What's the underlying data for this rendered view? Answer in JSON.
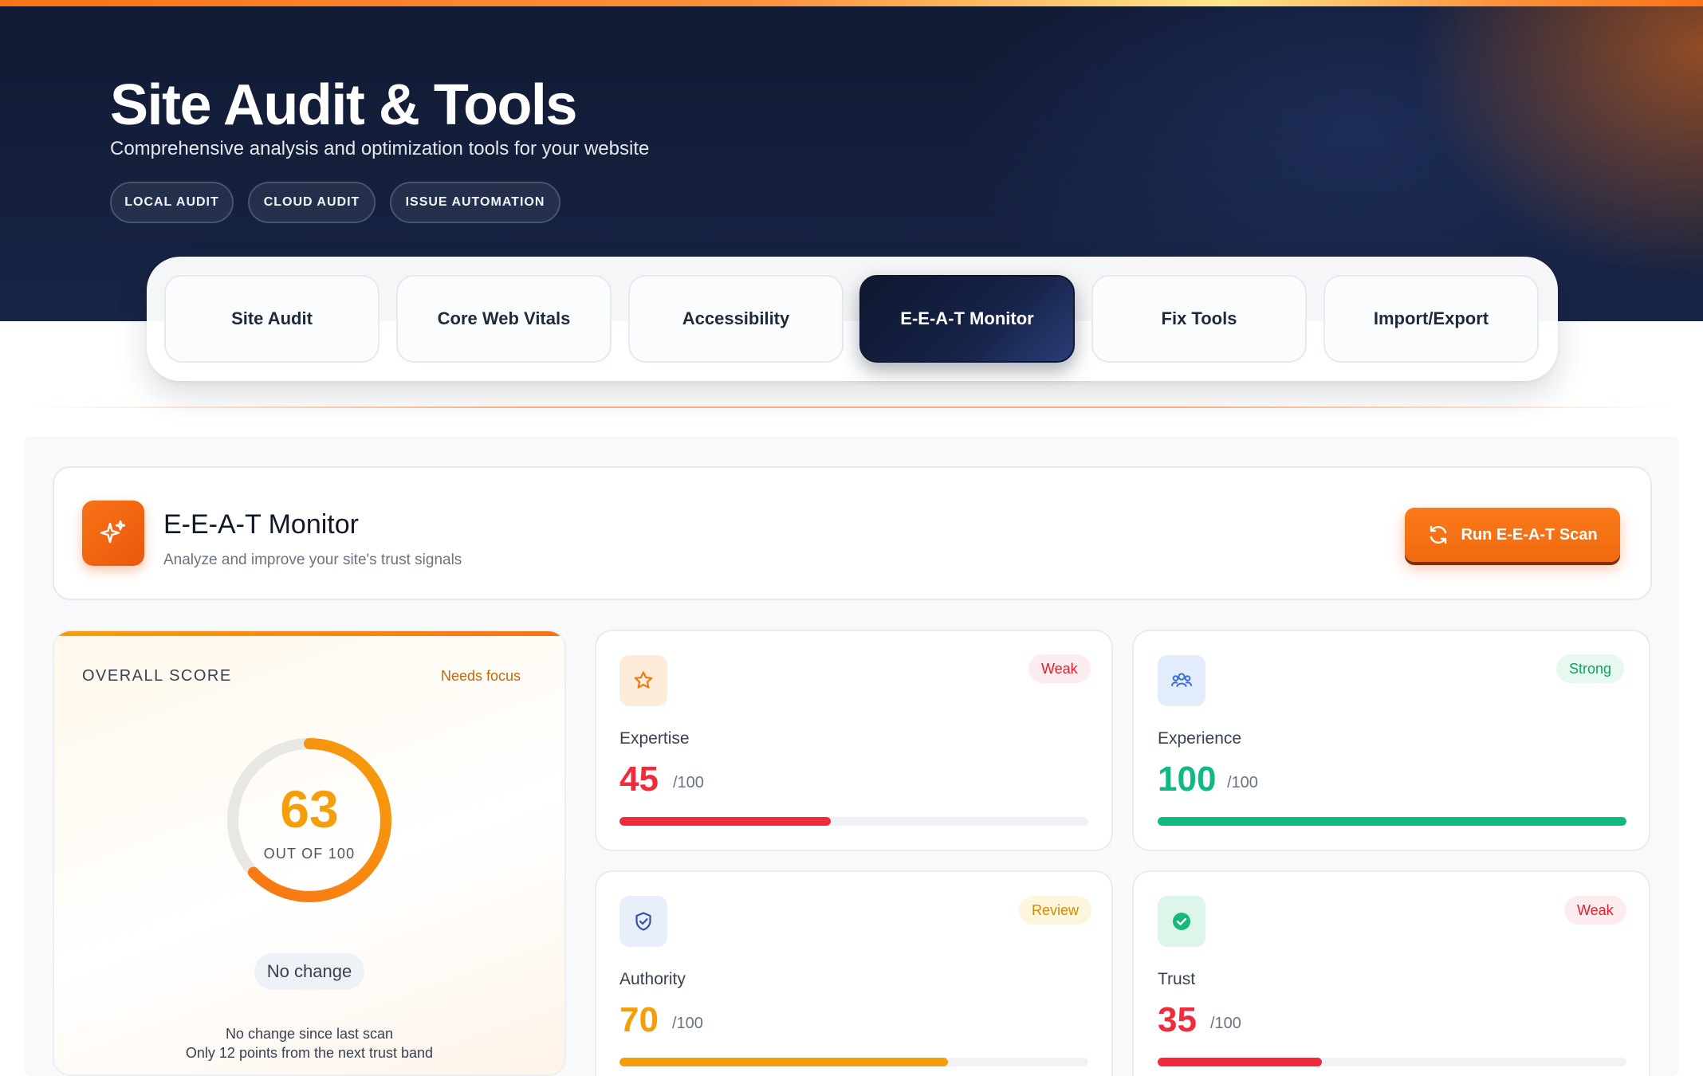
{
  "hero": {
    "title": "Site Audit & Tools",
    "subtitle": "Comprehensive analysis and optimization tools for your website",
    "pills": [
      "LOCAL AUDIT",
      "CLOUD AUDIT",
      "ISSUE AUTOMATION"
    ]
  },
  "tabs": [
    {
      "label": "Site Audit"
    },
    {
      "label": "Core Web Vitals"
    },
    {
      "label": "Accessibility"
    },
    {
      "label": "E-E-A-T Monitor",
      "active": true
    },
    {
      "label": "Fix Tools"
    },
    {
      "label": "Import/Export"
    }
  ],
  "header": {
    "icon": "sparkles-icon",
    "title": "E-E-A-T Monitor",
    "subtitle": "Analyze and improve your site's trust signals",
    "button_label": "Run E-E-A-T Scan",
    "button_icon": "refresh-icon"
  },
  "overall": {
    "label": "OVERALL SCORE",
    "status": "Needs focus",
    "score": "63",
    "score_value": 63,
    "max": 100,
    "caption": "OUT OF 100",
    "change": "No change",
    "note1": "No change since last scan",
    "note2": "Only 12 points from the next trust band"
  },
  "metrics": [
    {
      "name": "Expertise",
      "score": "45",
      "value": 45,
      "max_label": "/100",
      "badge": "Weak",
      "icon": "star-icon",
      "color": "#ef2b3c"
    },
    {
      "name": "Experience",
      "score": "100",
      "value": 100,
      "max_label": "/100",
      "badge": "Strong",
      "icon": "users-icon",
      "color": "#10b981"
    },
    {
      "name": "Authority",
      "score": "70",
      "value": 70,
      "max_label": "/100",
      "badge": "Review",
      "icon": "shield-check-icon",
      "color": "#f59e0b"
    },
    {
      "name": "Trust",
      "score": "35",
      "value": 35,
      "max_label": "/100",
      "badge": "Weak",
      "icon": "check-circle-icon",
      "color": "#ef2b3c"
    }
  ],
  "colors": {
    "accent": "#f97316",
    "navy": "#111a33",
    "weak": "#ef2b3c",
    "strong": "#10b981",
    "review": "#f59e0b"
  }
}
